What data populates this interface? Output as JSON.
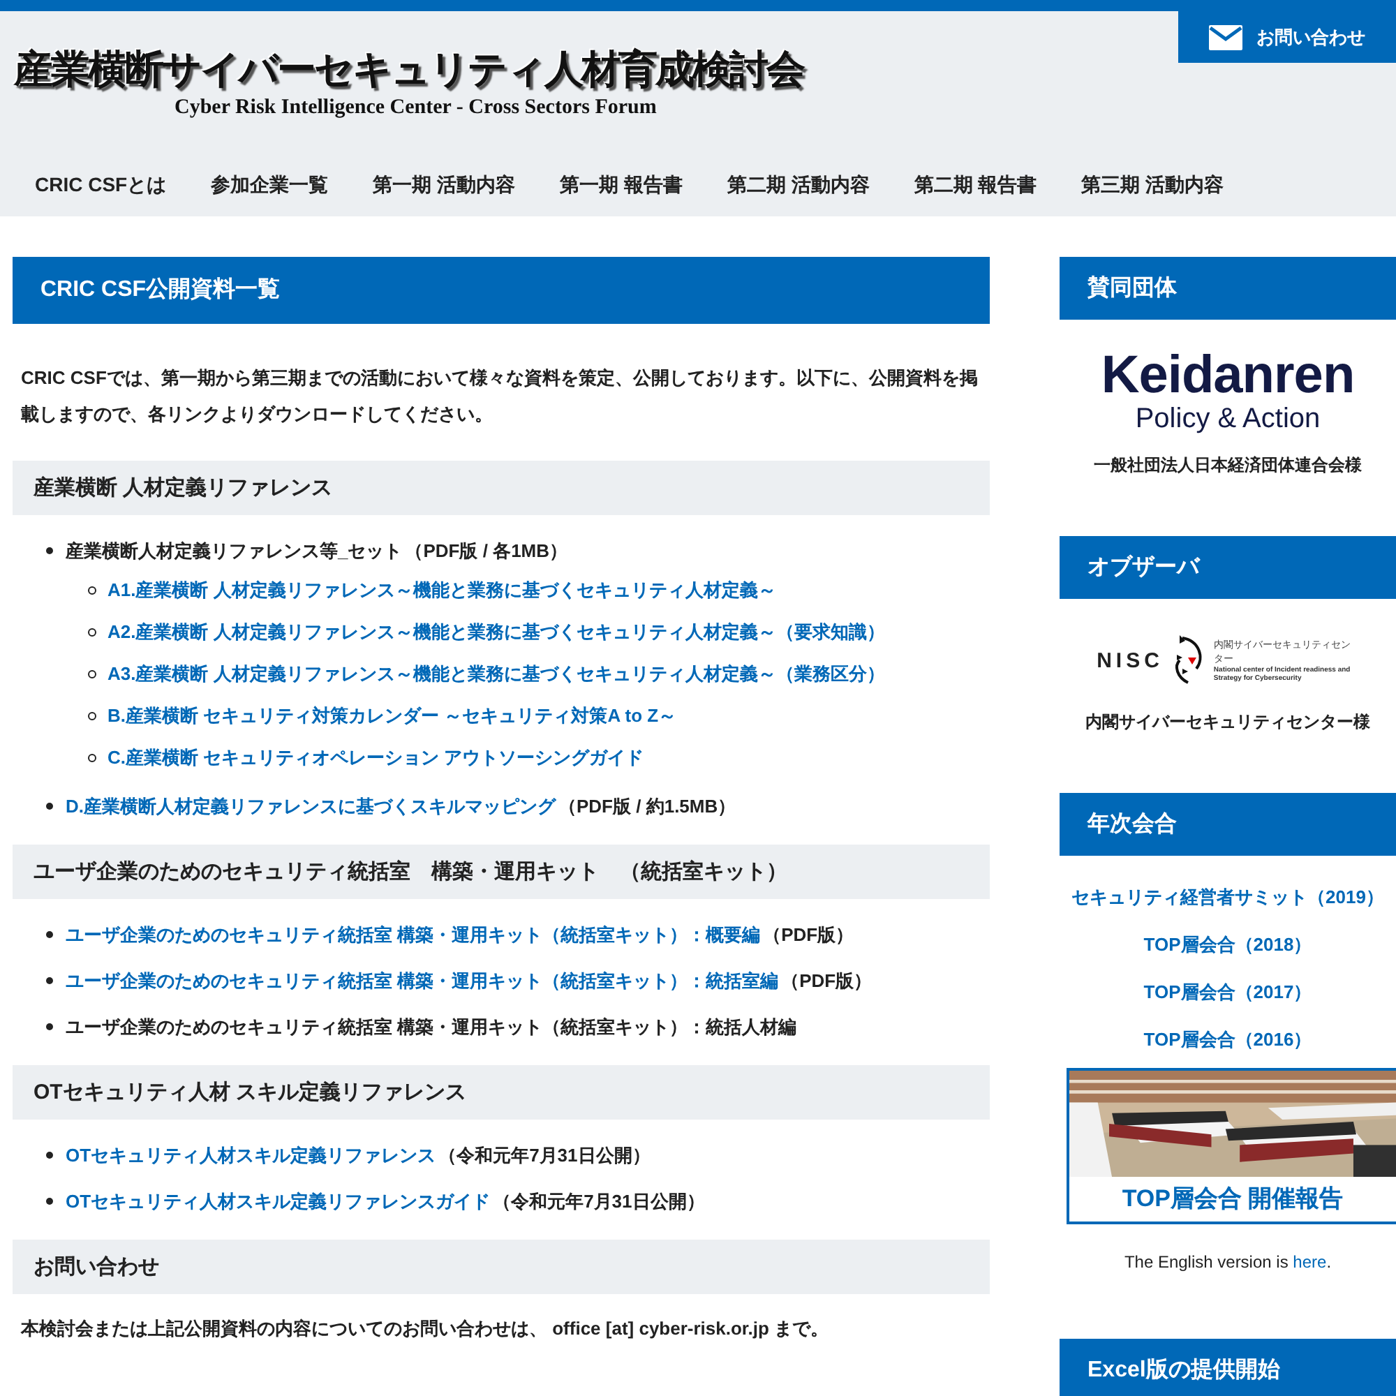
{
  "header": {
    "title": "産業横断サイバーセキュリティ人材育成検討会",
    "subtitle": "Cyber Risk Intelligence Center - Cross Sectors Forum",
    "contact_button": "お問い合わせ"
  },
  "nav": [
    "CRIC CSFとは",
    "参加企業一覧",
    "第一期 活動内容",
    "第一期 報告書",
    "第二期 活動内容",
    "第二期 報告書",
    "第三期 活動内容"
  ],
  "main": {
    "title": "CRIC CSF公開資料一覧",
    "intro": "CRIC CSFでは、第一期から第三期までの活動において様々な資料を策定、公開しております。以下に、公開資料を掲載しますので、各リンクよりダウンロードしてください。",
    "sections": [
      {
        "heading": "産業横断 人材定義リファレンス",
        "items": [
          {
            "kind": "text",
            "text": "産業横断人材定義リファレンス等_セット",
            "note": "（PDF版 / 各1MB）",
            "children": [
              {
                "kind": "link",
                "text": "A1.産業横断 人材定義リファレンス～機能と業務に基づくセキュリティ人材定義～"
              },
              {
                "kind": "link",
                "text": "A2.産業横断 人材定義リファレンス～機能と業務に基づくセキュリティ人材定義～（要求知識）"
              },
              {
                "kind": "link",
                "text": "A3.産業横断 人材定義リファレンス～機能と業務に基づくセキュリティ人材定義～（業務区分）"
              },
              {
                "kind": "link",
                "text": "B.産業横断 セキュリティ対策カレンダー ～セキュリティ対策A to Z～"
              },
              {
                "kind": "link",
                "text": "C.産業横断 セキュリティオペレーション アウトソーシングガイド"
              }
            ]
          },
          {
            "kind": "link",
            "text": "D.産業横断人材定義リファレンスに基づくスキルマッピング",
            "note": "（PDF版 / 約1.5MB）"
          }
        ]
      },
      {
        "heading": "ユーザ企業のためのセキュリティ統括室　構築・運用キット　（統括室キット）",
        "items": [
          {
            "kind": "link",
            "text": "ユーザ企業のためのセキュリティ統括室 構築・運用キット（統括室キット）：概要編",
            "note": "（PDF版）"
          },
          {
            "kind": "link",
            "text": "ユーザ企業のためのセキュリティ統括室 構築・運用キット（統括室キット）：統括室編",
            "note": "（PDF版）"
          },
          {
            "kind": "text",
            "text": "ユーザ企業のためのセキュリティ統括室 構築・運用キット（統括室キット）：統括人材編"
          }
        ]
      },
      {
        "heading": "OTセキュリティ人材 スキル定義リファレンス",
        "items": [
          {
            "kind": "link",
            "text": "OTセキュリティ人材スキル定義リファレンス",
            "note": "（令和元年7月31日公開）"
          },
          {
            "kind": "link",
            "text": "OTセキュリティ人材スキル定義リファレンスガイド",
            "note": "（令和元年7月31日公開）"
          }
        ]
      },
      {
        "heading": "お問い合わせ",
        "paragraph": "本検討会または上記公開資料の内容についてのお問い合わせは、 office [at] cyber-risk.or.jp まで。"
      }
    ]
  },
  "sidebar": [
    {
      "kind": "logo",
      "heading": "賛同団体",
      "logo_lines": [
        "Keidanren",
        "Policy & Action"
      ],
      "caption": "一般社団法人日本経済団体連合会様"
    },
    {
      "kind": "logo",
      "heading": "オブザーバ",
      "logo_lines": [
        "NISC",
        "内閣サイバーセキュリティセンター",
        "National center of Incident readiness and Strategy for Cybersecurity"
      ],
      "caption": "内閣サイバーセキュリティセンター様"
    },
    {
      "kind": "links",
      "heading": "年次会合",
      "links": [
        "セキュリティ経営者サミット（2019）",
        "TOP層会合（2018）",
        "TOP層会合（2017）",
        "TOP層会合（2016）"
      ],
      "banner": {
        "kind": "picture",
        "caption": "TOP層会合 開催報告"
      },
      "english": {
        "text": "The English version is ",
        "link": "here",
        "after": "."
      }
    },
    {
      "kind": "heading",
      "heading": "Excel版の提供開始"
    }
  ]
}
